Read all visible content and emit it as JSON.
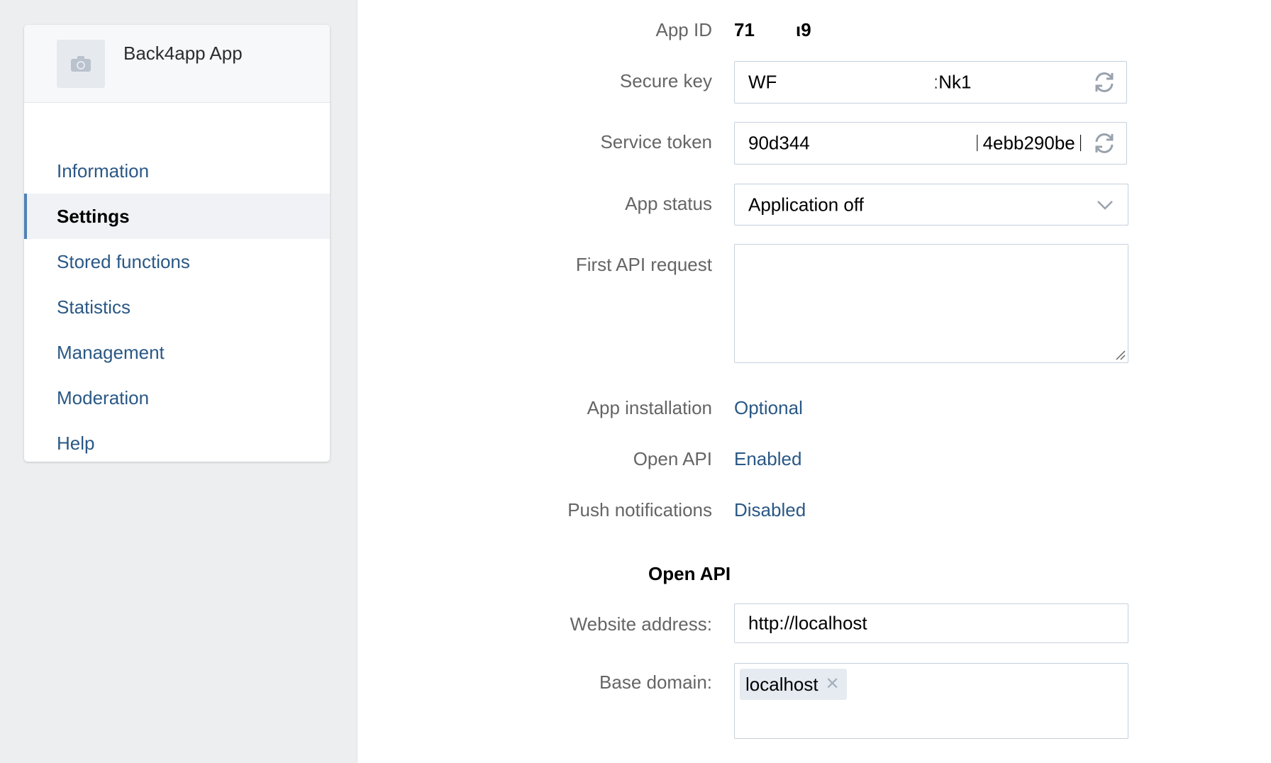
{
  "sidebar": {
    "app_name": "Back4app App",
    "avatar_icon": "camera-icon",
    "items": [
      {
        "label": "Information"
      },
      {
        "label": "Settings",
        "active": true
      },
      {
        "label": "Stored functions"
      },
      {
        "label": "Statistics"
      },
      {
        "label": "Management"
      },
      {
        "label": "Moderation"
      },
      {
        "label": "Help"
      }
    ]
  },
  "settings": {
    "app_id": {
      "label": "App ID",
      "value_start": "71",
      "value_end": "ι9"
    },
    "secure_key": {
      "label": "Secure key",
      "value_start": "WF",
      "value_end": "ːNk1"
    },
    "service_token": {
      "label": "Service token",
      "value_start": "90d344",
      "value_end": "ᛁ4ebb290beᛁ"
    },
    "app_status": {
      "label": "App status",
      "value": "Application off"
    },
    "first_api_request": {
      "label": "First API request",
      "value": ""
    },
    "app_installation": {
      "label": "App installation",
      "value": "Optional"
    },
    "open_api": {
      "label": "Open API",
      "value": "Enabled"
    },
    "push_notifications": {
      "label": "Push notifications",
      "value": "Disabled"
    }
  },
  "open_api_section": {
    "title": "Open API",
    "website_address": {
      "label": "Website address:",
      "value": "http://localhost"
    },
    "base_domain": {
      "label": "Base domain:",
      "tags": [
        "localhost"
      ]
    }
  },
  "colors": {
    "link": "#2a5885",
    "accent": "#5181b8",
    "label": "#656565"
  }
}
